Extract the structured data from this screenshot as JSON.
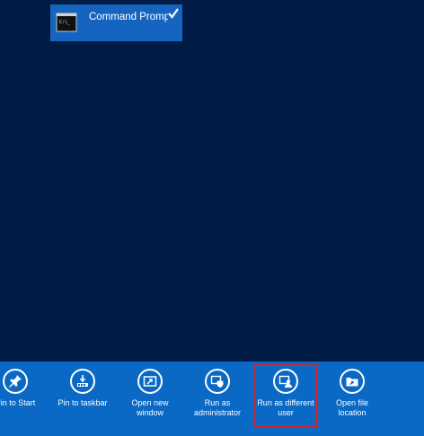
{
  "start_screen": {
    "tile": {
      "label": "Command Prompt",
      "icon": "command-prompt-icon",
      "selected": true
    }
  },
  "app_bar": {
    "commands": [
      {
        "id": "pin-to-start",
        "label": "Pin to Start",
        "icon": "pin-icon"
      },
      {
        "id": "pin-to-taskbar",
        "label": "Pin to taskbar",
        "icon": "taskbar-pin-icon"
      },
      {
        "id": "open-new-window",
        "label": "Open new\nwindow",
        "icon": "new-window-icon"
      },
      {
        "id": "run-as-administrator",
        "label": "Run as\nadministrator",
        "icon": "shield-icon"
      },
      {
        "id": "run-as-different-user",
        "label": "Run as different\nuser",
        "icon": "user-icon",
        "highlighted": true
      },
      {
        "id": "open-file-location",
        "label": "Open file\nlocation",
        "icon": "folder-icon"
      }
    ]
  },
  "colors": {
    "background": "#001b45",
    "tile": "#1565c0",
    "app_bar": "#0a69c4",
    "highlight": "#d9202a"
  }
}
